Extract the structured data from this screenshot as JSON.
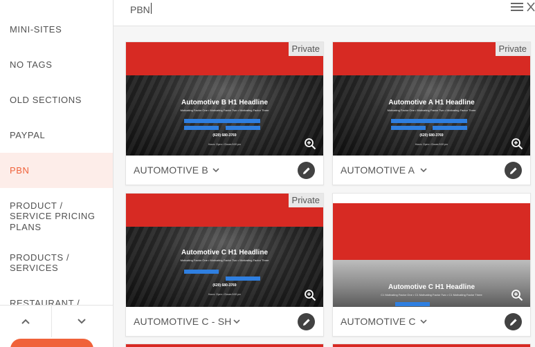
{
  "search": {
    "value": "PBN",
    "placeholder": ""
  },
  "sidebar": {
    "items": [
      {
        "label": "MINI-SITES",
        "active": false
      },
      {
        "label": "NO TAGS",
        "active": false
      },
      {
        "label": "OLD SECTIONS",
        "active": false
      },
      {
        "label": "PAYPAL",
        "active": false
      },
      {
        "label": "PBN",
        "active": true
      },
      {
        "label": "PRODUCT / SERVICE PRICING PLANS",
        "lines": [
          "PRODUCT /",
          "SERVICE PRICING",
          "PLANS"
        ],
        "active": false
      },
      {
        "label": "PRODUCTS / SERVICES",
        "lines": [
          "PRODUCTS /",
          "SERVICES"
        ],
        "active": false
      },
      {
        "label": "RESTAURANT /",
        "active": false
      }
    ]
  },
  "icons": {
    "menu": "hamburger-menu-icon",
    "close": "close-icon",
    "up": "chevron-up-icon",
    "down": "chevron-down-icon",
    "zoom": "zoom-in-icon",
    "edit": "pencil-icon"
  },
  "cards": [
    {
      "title": "AUTOMOTIVE B",
      "badge": "Private",
      "headline": "Automotive B H1 Headline",
      "subline": "Motivating Factor One  •  Motivating Factor Two  •  Motivating Factor Three",
      "phone": "(620) 680-3769",
      "hours": "Hours: Open • Closes 5:00 pm"
    },
    {
      "title": "AUTOMOTIVE A",
      "badge": "Private",
      "headline": "Automotive A H1 Headline",
      "subline": "Motivating Factor One  •  Motivating Factor Two  •  Motivating Factor Three",
      "phone": "(620) 680-3769",
      "hours": "Hours: Open • Closes 5:00 pm"
    },
    {
      "title": "AUTOMOTIVE C - SH",
      "badge": "Private",
      "headline": "Automotive C H1 Headline",
      "subline": "Motivating Factor One  •  Motivating Factor Two  •  Motivating Factor Three",
      "phone": "(620) 680-3769",
      "hours": "Hours: Open • Closes 5:00 pm"
    },
    {
      "title": "AUTOMOTIVE C",
      "badge": "",
      "headline": "Automotive C H1 Headline",
      "subline": "C1 Motivating Factor One  •  C1 Motivating Factor Two  •  C1 Motivating Factor Three",
      "phone": "",
      "hours": ""
    }
  ],
  "colors": {
    "accent": "#f0623a",
    "active_bg": "#fdede9",
    "banner_red": "#d72a23",
    "edit_btn": "#424242"
  }
}
